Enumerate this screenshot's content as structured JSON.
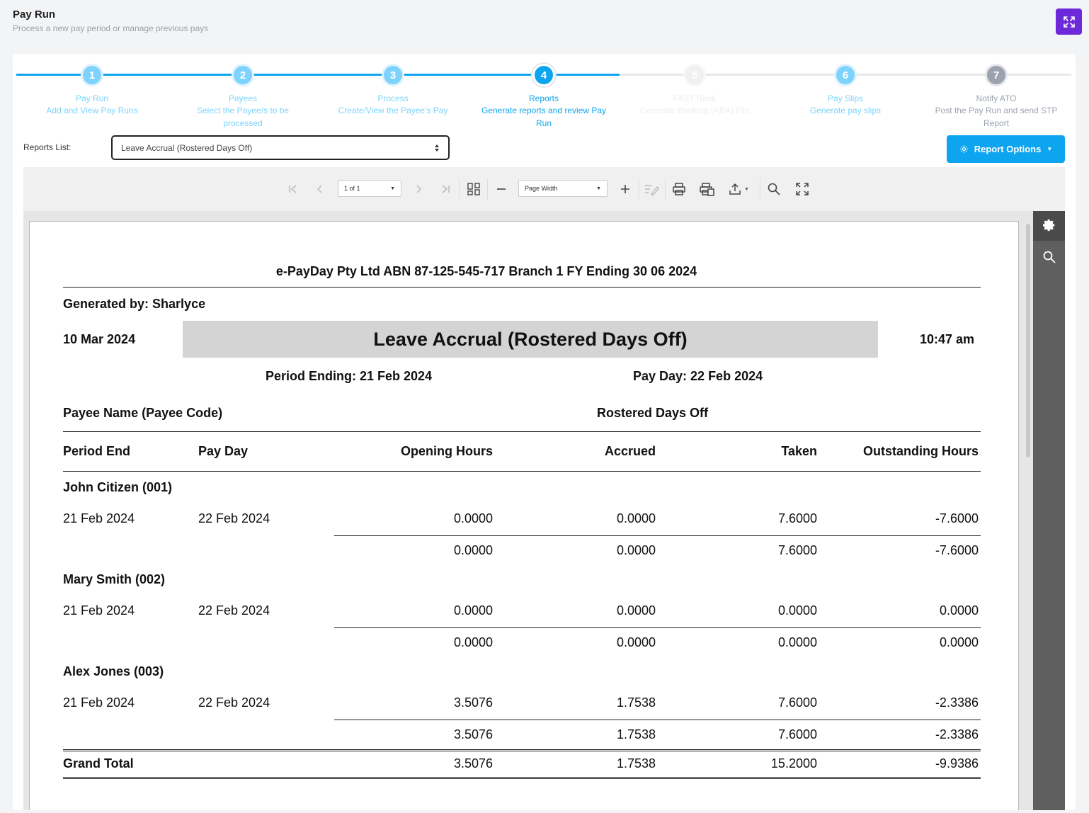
{
  "header": {
    "title": "Pay Run",
    "subtitle": "Process a new pay period or manage previous pays"
  },
  "steps": [
    {
      "number": "1",
      "title": "Pay Run",
      "desc": "Add and View Pay Runs"
    },
    {
      "number": "2",
      "title": "Payees",
      "desc": "Select the Payee/s to be processed"
    },
    {
      "number": "3",
      "title": "Process",
      "desc": "Create/View the Payee's Pay"
    },
    {
      "number": "4",
      "title": "Reports",
      "desc": "Generate reports and review Pay Run"
    },
    {
      "number": "5",
      "title": "FAST Bank",
      "desc": "Generate Banking (ABA) File"
    },
    {
      "number": "6",
      "title": "Pay Slips",
      "desc": "Generate pay slips"
    },
    {
      "number": "7",
      "title": "Notify ATO",
      "desc": "Post the Pay Run and send STP Report"
    }
  ],
  "reports": {
    "label": "Reports List:",
    "selected": "Leave Accrual (Rostered Days Off)",
    "options_button": "Report Options"
  },
  "toolbar": {
    "page_select": "1 of 1",
    "zoom_select": "Page Width"
  },
  "report": {
    "company": "e-PayDay Pty Ltd ABN 87-125-545-717 Branch 1 FY Ending 30 06 2024",
    "generated_by": "Generated by: Sharlyce",
    "date": "10 Mar 2024",
    "title": "Leave Accrual (Rostered Days Off)",
    "time": "10:47 am",
    "period_ending": "Period Ending: 21 Feb 2024",
    "pay_day": "Pay Day: 22 Feb 2024",
    "payee_header": "Payee Name (Payee Code)",
    "section_header": "Rostered Days Off",
    "columns": [
      "Period End",
      "Pay Day",
      "Opening Hours",
      "Accrued",
      "Taken",
      "Outstanding Hours"
    ],
    "payees": [
      {
        "name": "John Citizen (001)",
        "row": [
          "21 Feb 2024",
          "22 Feb 2024",
          "0.0000",
          "0.0000",
          "7.6000",
          "-7.6000"
        ],
        "subtotal": [
          "0.0000",
          "0.0000",
          "7.6000",
          "-7.6000"
        ]
      },
      {
        "name": "Mary Smith (002)",
        "row": [
          "21 Feb 2024",
          "22 Feb 2024",
          "0.0000",
          "0.0000",
          "0.0000",
          "0.0000"
        ],
        "subtotal": [
          "0.0000",
          "0.0000",
          "0.0000",
          "0.0000"
        ]
      },
      {
        "name": "Alex Jones (003)",
        "row": [
          "21 Feb 2024",
          "22 Feb 2024",
          "3.5076",
          "1.7538",
          "7.6000",
          "-2.3386"
        ],
        "subtotal": [
          "3.5076",
          "1.7538",
          "7.6000",
          "-2.3386"
        ]
      }
    ],
    "grand_total_label": "Grand Total",
    "grand_total": [
      "3.5076",
      "1.7538",
      "15.2000",
      "-9.9386"
    ]
  },
  "colors": {
    "accent": "#0ea5f0",
    "active_step": "#0ea5f0",
    "done_step": "#7dd3fc",
    "disabled_step": "#e5e7eb",
    "notify_step": "#9ca3af",
    "expand_button": "#6d28d9",
    "title_band": "#d4d4d4"
  }
}
